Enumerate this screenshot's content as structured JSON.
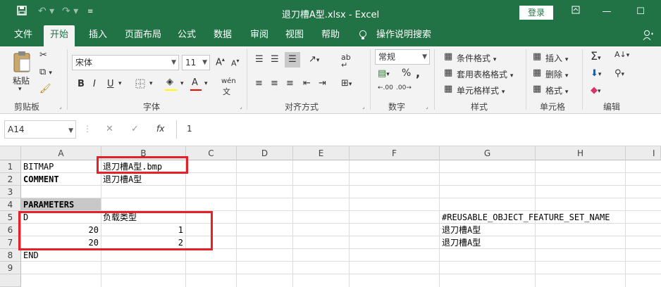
{
  "titlebar": {
    "title": "退刀槽A型.xlsx  -  Excel",
    "login": "登录",
    "save_icon": "save-icon",
    "undo_icon": "undo-icon",
    "redo_icon": "redo-icon",
    "customize_icon": "customize-qat-icon"
  },
  "menu": {
    "items": [
      "文件",
      "开始",
      "插入",
      "页面布局",
      "公式",
      "数据",
      "审阅",
      "视图",
      "帮助"
    ],
    "search": "操作说明搜索",
    "active": "开始"
  },
  "ribbon": {
    "clipboard": {
      "paste": "粘贴",
      "label": "剪贴板"
    },
    "font": {
      "name": "宋体",
      "size": "11",
      "label": "字体",
      "bold": "B",
      "italic": "I",
      "underline": "U",
      "grow": "A",
      "shrink": "A",
      "phonetic": "wén",
      "fill_color": "#ffff00",
      "font_color": "#ff0000"
    },
    "alignment": {
      "label": "对齐方式"
    },
    "number": {
      "format": "常规",
      "label": "数字",
      "percent": "%",
      "comma": ",",
      "inc_decimal": ".00",
      "dec_decimal": ".00"
    },
    "styles": {
      "conditional": "条件格式",
      "table": "套用表格格式",
      "cell": "单元格样式",
      "label": "样式"
    },
    "cells": {
      "insert": "插入",
      "delete": "删除",
      "format": "格式",
      "label": "单元格"
    },
    "editing": {
      "label": "编辑"
    }
  },
  "formula_bar": {
    "name_box": "A14",
    "fx": "fx",
    "value": "1"
  },
  "sheet": {
    "columns": [
      "A",
      "B",
      "C",
      "D",
      "E",
      "F",
      "G",
      "H",
      "I"
    ],
    "rows": [
      "1",
      "2",
      "3",
      "4",
      "5",
      "6",
      "7",
      "8",
      "9"
    ],
    "cells": {
      "A1": "BITMAP",
      "B1": "退刀槽A型.bmp",
      "A2": "COMMENT",
      "B2": "退刀槽A型",
      "A4": "PARAMETERS",
      "A5": "D",
      "B5": "负载类型",
      "G5": "#REUSABLE_OBJECT_FEATURE_SET_NAME",
      "A6": "20",
      "B6": "1",
      "G6": "退刀槽A型",
      "A7": "20",
      "B7": "2",
      "G7": "退刀槽A型",
      "A8": "END"
    },
    "highlight_color": "#e3212b",
    "header_fill": "#c8c8c8"
  }
}
